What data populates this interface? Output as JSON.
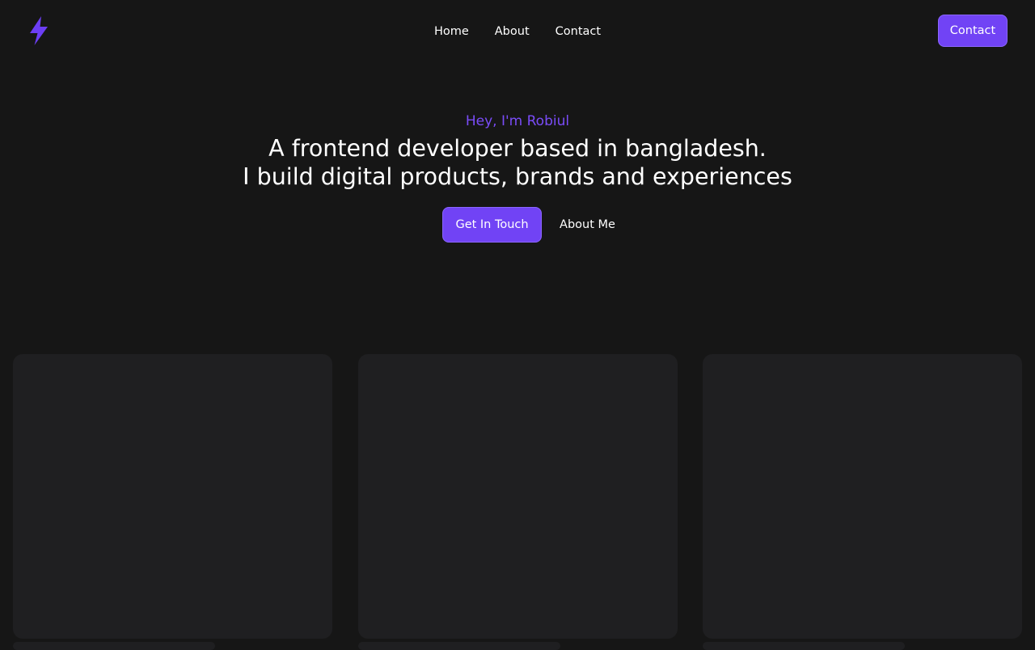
{
  "nav": {
    "logo_icon": "lightning-bolt-icon",
    "links": [
      "Home",
      "About",
      "Contact"
    ],
    "contact_button": "Contact"
  },
  "hero": {
    "greeting": "Hey, I'm Robiul",
    "headline_line1": "A frontend developer based in bangladesh.",
    "headline_line2": "I build digital products, brands and experiences",
    "primary_cta": "Get In Touch",
    "secondary_cta": "About Me"
  },
  "colors": {
    "background": "#161616",
    "accent": "#7143f5",
    "accent_text": "#7a4cf8",
    "card": "#1f1f21",
    "text": "#ffffff"
  }
}
